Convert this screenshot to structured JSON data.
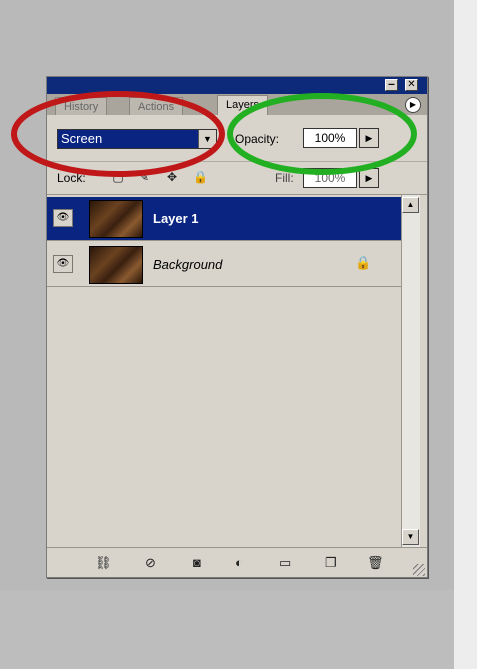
{
  "palette": {
    "tabs": [
      {
        "label": "History"
      },
      {
        "label": "Actions"
      },
      {
        "label": "Layers"
      }
    ],
    "blend_mode": {
      "value": "Screen"
    },
    "opacity": {
      "label": "Opacity:",
      "value": "100%"
    },
    "lock": {
      "label": "Lock:"
    },
    "fill": {
      "label": "Fill:",
      "value": "100%"
    },
    "layers": [
      {
        "name": "Layer 1",
        "selected": true,
        "visible": true
      },
      {
        "name": "Background",
        "selected": false,
        "visible": true,
        "locked": true
      }
    ],
    "bottom_icons": [
      "link-icon",
      "layer-style-icon",
      "mask-icon",
      "adjustment-layer-icon",
      "new-group-icon",
      "new-layer-icon",
      "trash-icon"
    ]
  },
  "colors": {
    "title_bar": "#0d2a7a",
    "selection": "#0a2482",
    "annotation_red": "#c01818",
    "annotation_green": "#22b022"
  }
}
